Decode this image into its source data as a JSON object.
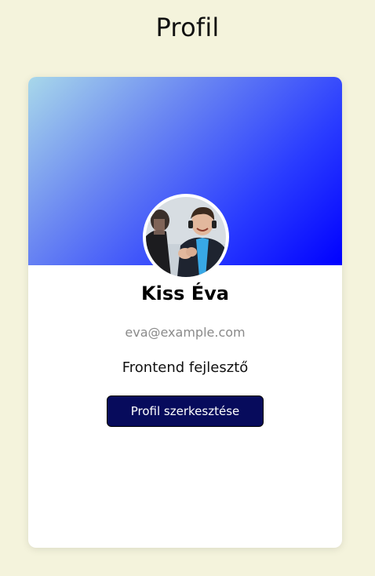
{
  "page": {
    "title": "Profil"
  },
  "profile": {
    "name": "Kiss Éva",
    "email": "eva@example.com",
    "role": "Frontend fejlesztő",
    "edit_button_label": "Profil szerkesztése"
  },
  "colors": {
    "background": "#f4f3dc",
    "card": "#ffffff",
    "header_gradient_start": "#a8d8ea",
    "header_gradient_end": "#0000ff",
    "button_bg": "#070b5c",
    "email_text": "#8a8a8a"
  }
}
